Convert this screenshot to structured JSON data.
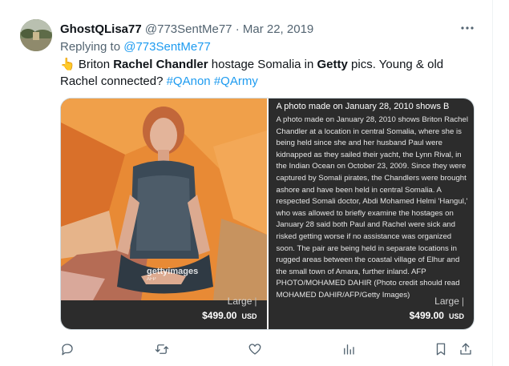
{
  "tweet": {
    "author_name": "GhostQLisa77",
    "handle": "@773SentMe77",
    "separator": "·",
    "date": "Mar 22, 2019",
    "replying_to_prefix": "Replying to",
    "replying_to_handle": "@773SentMe77",
    "text": {
      "emoji": "👆",
      "part1": " Briton ",
      "bold1": "Rachel Chandler",
      "part2": " hostage Somalia in ",
      "bold2": "Getty",
      "part3": " pics. Young & old Rachel connected? ",
      "hashtag1": "#QAnon",
      "space": " ",
      "hashtag2": "#QArmy"
    }
  },
  "media": {
    "left": {
      "watermark": "gettyimages",
      "watermark_sub": "AFP",
      "size_label": "Large",
      "size_bar": "|",
      "price": "$499.00",
      "currency": "USD"
    },
    "right": {
      "caption_head": "A photo made on January 28, 2010 shows B",
      "caption": "A photo made on January 28, 2010 shows Briton Rachel Chandler at a location in central Somalia, where she is being held since she and her husband Paul were kidnapped as they sailed their yacht, the Lynn Rival, in the Indian Ocean on October 23, 2009. Since they were captured by Somali pirates, the Chandlers were brought ashore and have been held in central Somalia. A respected Somali doctor, Abdi Mohamed Helmi 'Hangul,' who was allowed to briefly examine the hostages on January 28 said both Paul and Rachel were sick and risked getting worse if no assistance was organized soon. The pair are being held in separate locations in rugged areas between the coastal village of Elhur and the small town of Amara, further inland. AFP PHOTO/MOHAMED DAHIR (Photo credit should read MOHAMED DAHIR/AFP/Getty Images)",
      "size_label": "Large",
      "size_bar": "|",
      "price": "$499.00",
      "currency": "USD"
    }
  },
  "actions": {
    "icons": [
      "reply-icon",
      "retweet-icon",
      "like-icon",
      "views-icon",
      "bookmark-icon",
      "share-icon"
    ]
  },
  "colors": {
    "accent": "#1d9bf0",
    "secondary_text": "#536471",
    "primary_text": "#0f1419",
    "panel_bg": "#2c2c2c",
    "photo_orange": "#e87f2b"
  }
}
